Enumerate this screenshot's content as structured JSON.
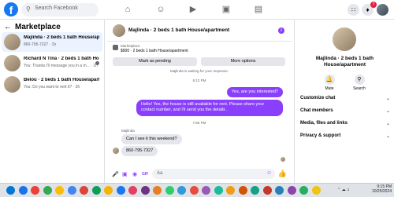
{
  "topbar": {
    "logo": "f",
    "search_placeholder": "Search Facebook",
    "notification_count": "7"
  },
  "sidebar": {
    "title": "Marketplace",
    "conversations": [
      {
        "name": "Majlinda · 2 beds 1 bath House/apartment",
        "preview": "860-795-7327 · 1h"
      },
      {
        "name": "Richard N Tina · 2 beds 1 bath House/...",
        "preview": "You: Thanks I'll message you in a m... · 1h"
      },
      {
        "name": "Belou · 2 beds 1 bath House/apartment",
        "preview": "You: Do you want to rent it? · 3h"
      }
    ]
  },
  "chat": {
    "title": "Majlinda · 2 beds 1 bath House/apartment",
    "listing_label": "Marketplace",
    "listing_price": "$900 · 2 beds 1 bath House/apartment",
    "mark_pending_label": "Mark as pending",
    "more_options_label": "More options",
    "system_message": "Majlinda is waiting for your response.",
    "time1": "6:12 PM",
    "out_msg1": "Yes, are you interested?",
    "out_msg2": "Hello! Yes, the house is still available for rent. Please share your contact number, and I'll send you the details .",
    "time2": "7:55 PM",
    "sender_name": "Majlinda",
    "in_msg1": "Can I see it this weekend?",
    "in_msg2": "860-795-7327",
    "composer_placeholder": "Aa"
  },
  "info_panel": {
    "name": "Majlinda · 2 beds 1 bath House/apartment",
    "mute_label": "Mute",
    "search_label": "Search",
    "sections": [
      "Customize chat",
      "Chat members",
      "Media, files and links",
      "Privacy & support"
    ]
  },
  "taskbar": {
    "time": "9:15 PM",
    "date": "10/25/2024",
    "app_colors": [
      "#0078d4",
      "#1a73e8",
      "#ea4335",
      "#34a853",
      "#fbbc05",
      "#4285f4",
      "#db4437",
      "#0f9d58",
      "#f4b400",
      "#1877f2",
      "#e4405f",
      "#6c3483",
      "#e67e22",
      "#2ecc71",
      "#3498db",
      "#e74c3c",
      "#9b59b6",
      "#1abc9c",
      "#f39c12",
      "#d35400",
      "#16a085",
      "#c0392b",
      "#2980b9",
      "#8e44ad",
      "#27ae60",
      "#f1c40f"
    ]
  }
}
